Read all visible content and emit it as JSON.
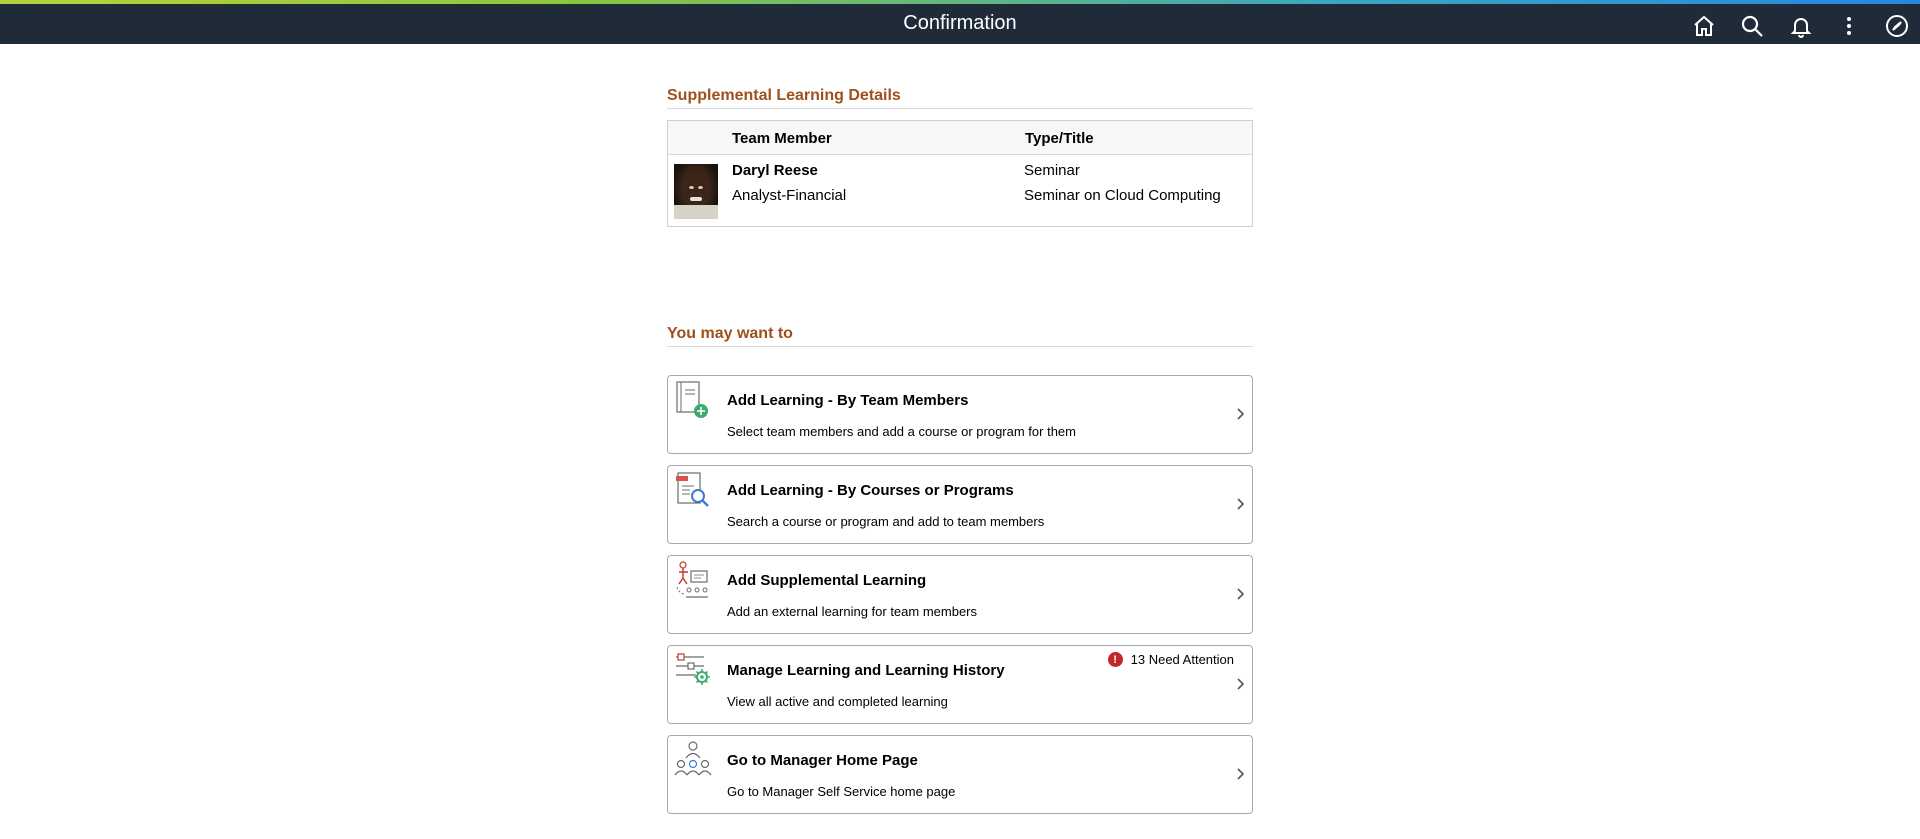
{
  "header": {
    "title": "Confirmation",
    "icons": [
      "home-icon",
      "search-icon",
      "bell-icon",
      "more-icon",
      "navbar-icon"
    ]
  },
  "details": {
    "section_title": "Supplemental Learning Details",
    "columns": {
      "member": "Team Member",
      "type_title": "Type/Title"
    },
    "row": {
      "name": "Daryl Reese",
      "job": "Analyst-Financial",
      "type": "Seminar",
      "title": "Seminar on Cloud Computing"
    }
  },
  "actions": {
    "section_title": "You may want to",
    "tiles": [
      {
        "title": "Add Learning - By Team Members",
        "desc": "Select team members and add a course or program for them",
        "icon": "add-document-icon"
      },
      {
        "title": "Add Learning - By Courses or Programs",
        "desc": "Search a course or program and add to team members",
        "icon": "document-search-icon"
      },
      {
        "title": "Add Supplemental Learning",
        "desc": "Add an external learning for team members",
        "icon": "presentation-icon"
      },
      {
        "title": "Manage Learning and Learning History",
        "desc": "View all active and completed learning",
        "icon": "manage-settings-icon",
        "badge": "13 Need Attention"
      },
      {
        "title": "Go to Manager Home Page",
        "desc": "Go to Manager Self Service home page",
        "icon": "team-icon"
      }
    ]
  },
  "colors": {
    "header_bg": "#1f2b38",
    "section_title": "#a0501c",
    "alert": "#c0282d"
  }
}
